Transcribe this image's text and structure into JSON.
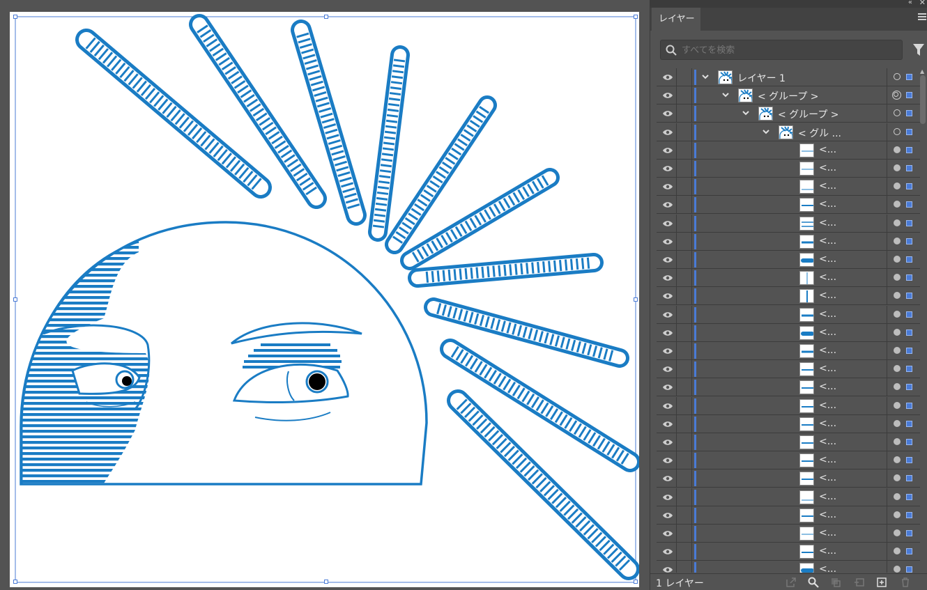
{
  "panel": {
    "tab_label": "レイヤー",
    "search_placeholder": "すべてを検索",
    "footer_count": "1 レイヤー"
  },
  "layers": [
    {
      "label": "レイヤー 1",
      "indent": 0,
      "expanded": true,
      "thumb": "art",
      "target": "single"
    },
    {
      "label": "< グループ >",
      "indent": 1,
      "expanded": true,
      "thumb": "art",
      "target": "double"
    },
    {
      "label": "< グループ >",
      "indent": 2,
      "expanded": true,
      "thumb": "art",
      "target": "single"
    },
    {
      "label": "< グル ...",
      "indent": 3,
      "expanded": true,
      "thumb": "art",
      "target": "single"
    },
    {
      "label": "<...",
      "indent": 4,
      "thumb": "line-mid"
    },
    {
      "label": "<...",
      "indent": 4,
      "thumb": "line-mid"
    },
    {
      "label": "<...",
      "indent": 4,
      "thumb": "line-low"
    },
    {
      "label": "<...",
      "indent": 4,
      "thumb": "line-mid2"
    },
    {
      "label": "<...",
      "indent": 4,
      "thumb": "line-two"
    },
    {
      "label": "<...",
      "indent": 4,
      "thumb": "line-thick"
    },
    {
      "label": "<...",
      "indent": 4,
      "thumb": "line-blob"
    },
    {
      "label": "<...",
      "indent": 4,
      "thumb": "line-vert"
    },
    {
      "label": "<...",
      "indent": 4,
      "thumb": "line-vert2"
    },
    {
      "label": "<...",
      "indent": 4,
      "thumb": "line-thick"
    },
    {
      "label": "<...",
      "indent": 4,
      "thumb": "line-blob"
    },
    {
      "label": "<...",
      "indent": 4,
      "thumb": "line-thick"
    },
    {
      "label": "<...",
      "indent": 4,
      "thumb": "line-mid2"
    },
    {
      "label": "<...",
      "indent": 4,
      "thumb": "line-mid2"
    },
    {
      "label": "<...",
      "indent": 4,
      "thumb": "line-mid2"
    },
    {
      "label": "<...",
      "indent": 4,
      "thumb": "line-mid2"
    },
    {
      "label": "<...",
      "indent": 4,
      "thumb": "line-mid2"
    },
    {
      "label": "<...",
      "indent": 4,
      "thumb": "line-mid2"
    },
    {
      "label": "<...",
      "indent": 4,
      "thumb": "line-mid2"
    },
    {
      "label": "<...",
      "indent": 4,
      "thumb": "line-low"
    },
    {
      "label": "<...",
      "indent": 4,
      "thumb": "line-mid2"
    },
    {
      "label": "<...",
      "indent": 4,
      "thumb": "line-mid"
    },
    {
      "label": "<...",
      "indent": 4,
      "thumb": "line-mid2"
    },
    {
      "label": "<...",
      "indent": 4,
      "thumb": "line-blob"
    }
  ],
  "colors": {
    "art_stroke": "#1a7cc4",
    "art_fill_light": "#d8ecf8",
    "selection": "#4a7bd6",
    "panel_bg": "#535353"
  }
}
